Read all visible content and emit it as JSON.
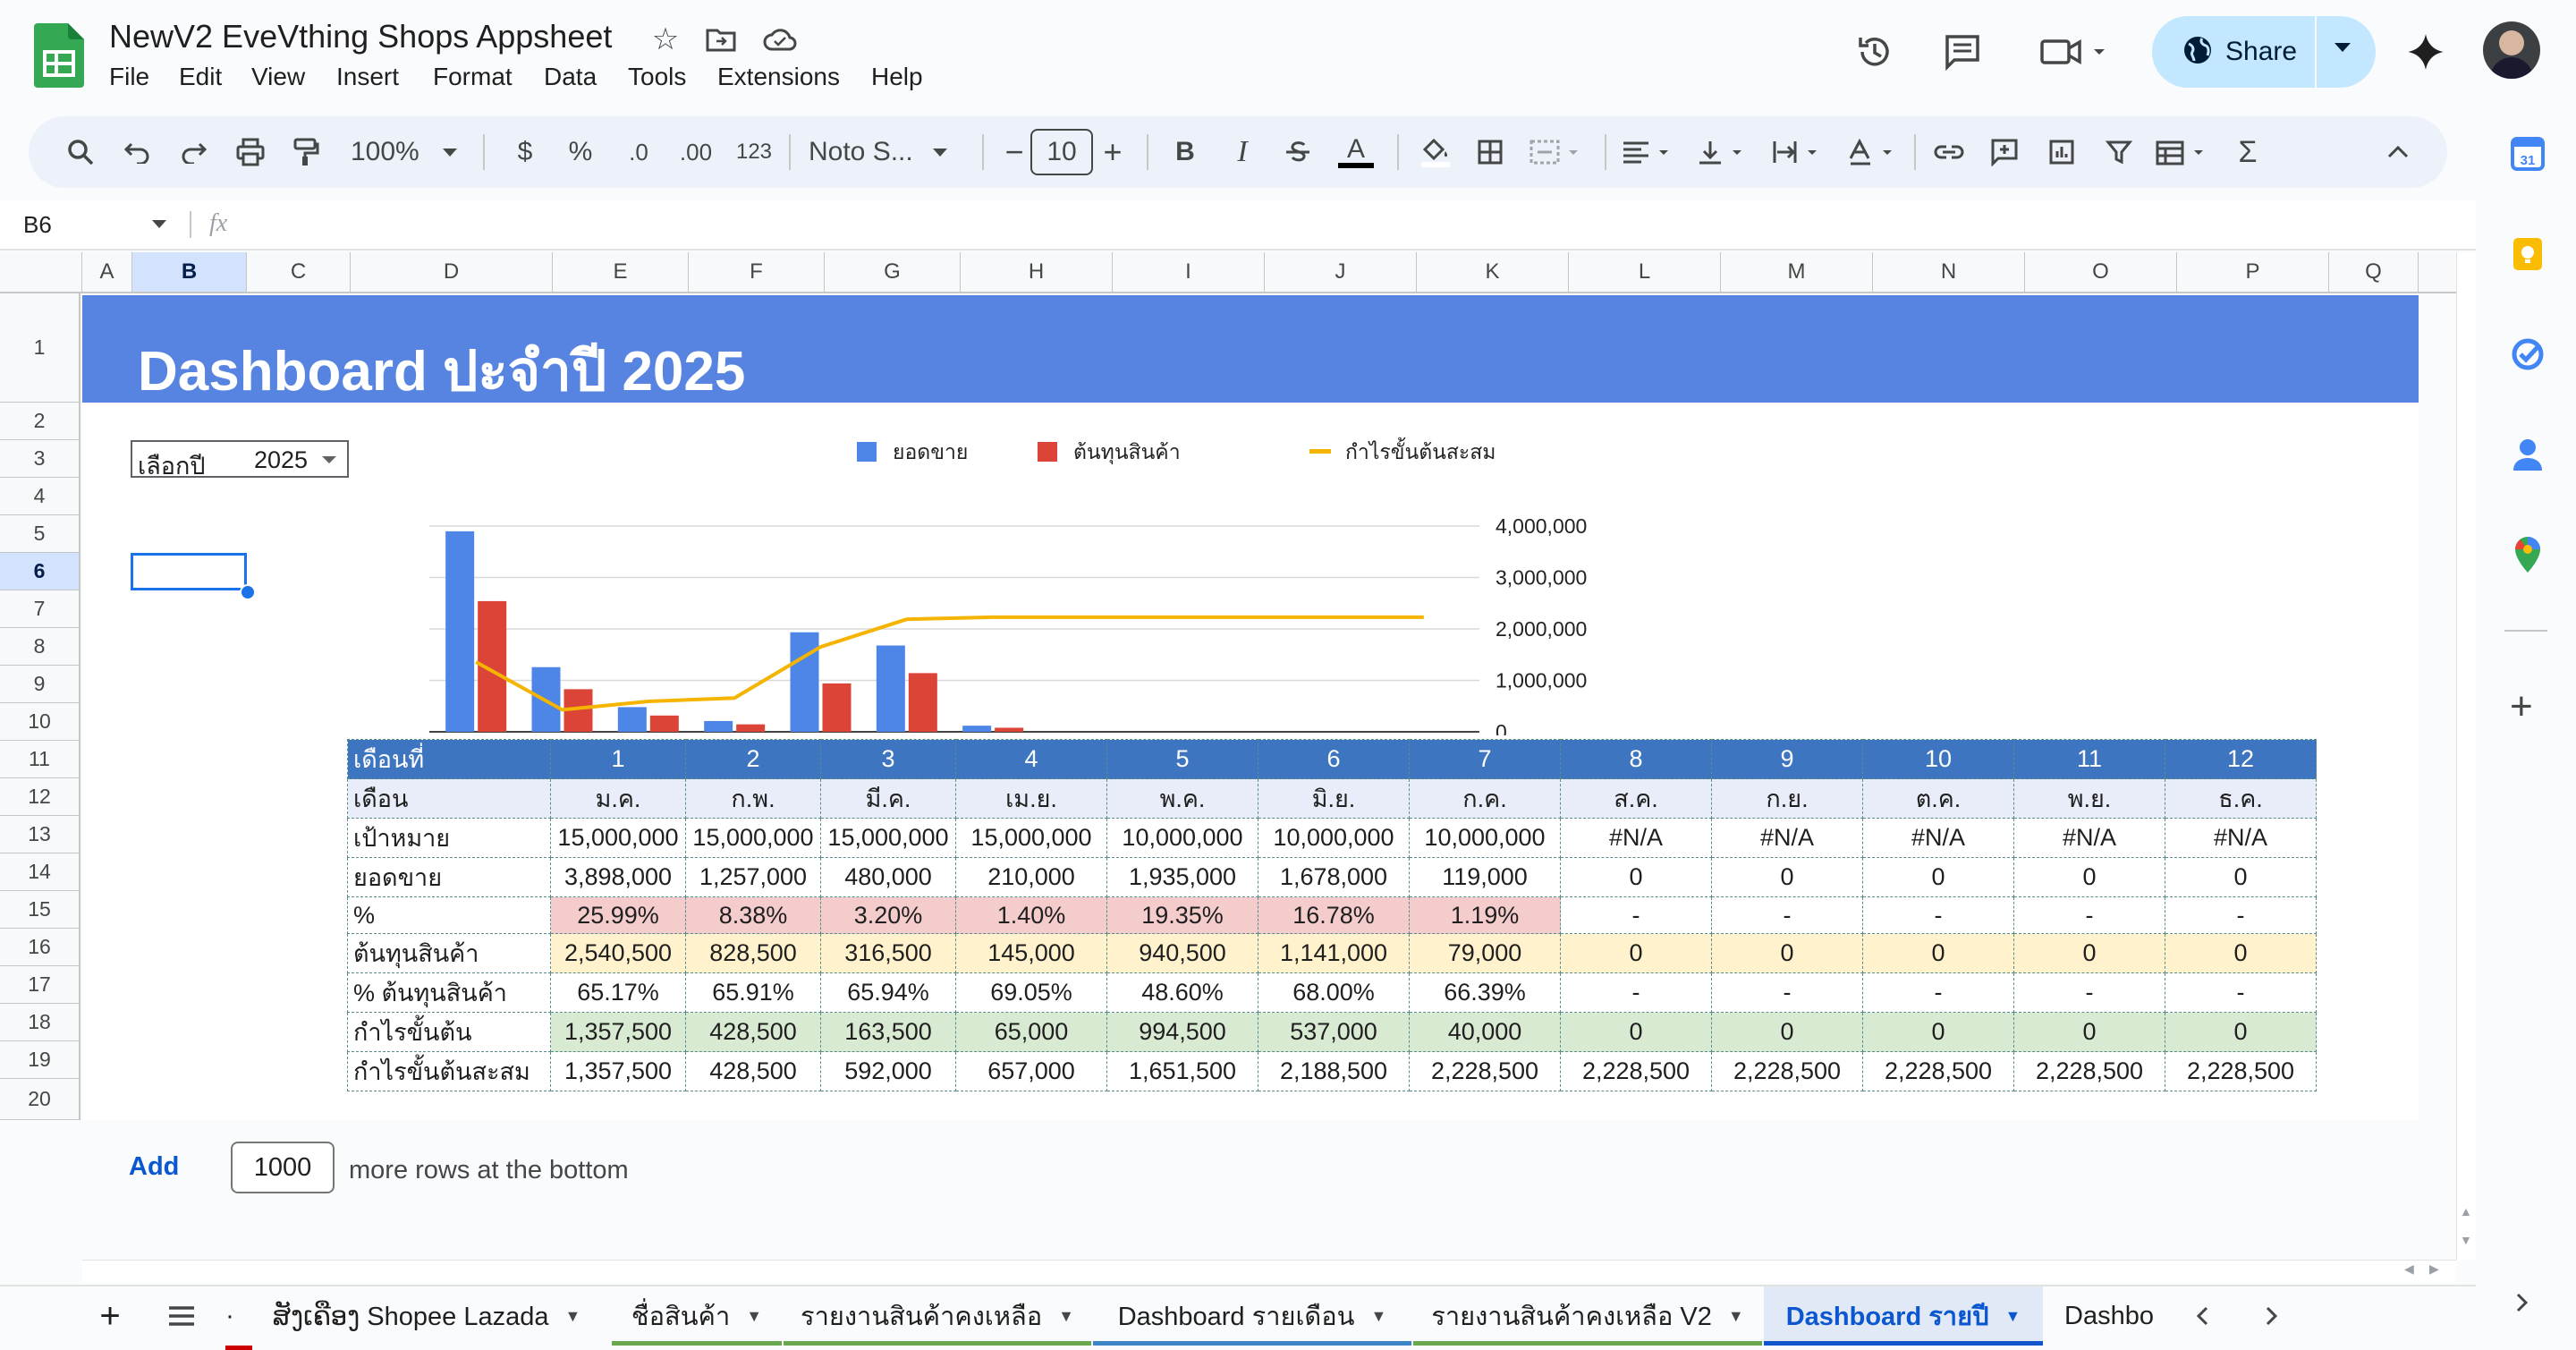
{
  "app": {
    "title": "NewV2 EveVthing Shops Appsheet",
    "menu": [
      "File",
      "Edit",
      "View",
      "Insert",
      "Format",
      "Data",
      "Tools",
      "Extensions",
      "Help"
    ],
    "share_label": "Share"
  },
  "toolbar": {
    "zoom": "100%",
    "currency": "$",
    "percent": "%",
    "dec_decrease": ".0",
    "dec_increase": ".00",
    "number_format": "123",
    "font": "Noto S...",
    "font_size": "10",
    "bold": "B",
    "italic": "I",
    "text_color_glyph": "A"
  },
  "formula_bar": {
    "name_box": "B6",
    "fx": "fx",
    "content": ""
  },
  "columns": [
    "A",
    "B",
    "C",
    "D",
    "E",
    "F",
    "G",
    "H",
    "I",
    "J",
    "K",
    "L",
    "M",
    "N",
    "O",
    "P",
    "Q"
  ],
  "rows": [
    "1",
    "2",
    "3",
    "4",
    "5",
    "6",
    "7",
    "8",
    "9",
    "10",
    "11",
    "12",
    "13",
    "14",
    "15",
    "16",
    "17",
    "18",
    "19",
    "20"
  ],
  "dashboard": {
    "title": "Dashboard ปะจำปี 2025",
    "year_label": "เลือกปี",
    "year_value": "2025"
  },
  "chart_data": {
    "type": "bar",
    "categories": [
      "ม.ค.",
      "ก.พ.",
      "มี.ค.",
      "เม.ย.",
      "พ.ค.",
      "มิ.ย.",
      "ก.ค.",
      "ส.ค.",
      "ก.ย.",
      "ต.ค.",
      "พ.ย.",
      "ธ.ค."
    ],
    "series": [
      {
        "name": "ยอดขาย",
        "type": "bar",
        "color": "#4e86e8",
        "values": [
          3898000,
          1257000,
          480000,
          210000,
          1935000,
          1678000,
          119000,
          0,
          0,
          0,
          0,
          0
        ]
      },
      {
        "name": "ต้นทุนสินค้า",
        "type": "bar",
        "color": "#db4437",
        "values": [
          2540500,
          828500,
          316500,
          145000,
          940500,
          1141000,
          79000,
          0,
          0,
          0,
          0,
          0
        ]
      },
      {
        "name": "กำไรขั้นต้นสะสม",
        "type": "line",
        "color": "#f4b400",
        "values": [
          1357500,
          428500,
          592000,
          657000,
          1651500,
          2188500,
          2228500,
          2228500,
          2228500,
          2228500,
          2228500,
          2228500
        ]
      }
    ],
    "ylim": [
      0,
      4000000
    ],
    "yticks": [
      "4,000,000",
      "3,000,000",
      "2,000,000",
      "1,000,000",
      "0"
    ],
    "legend_position": "top",
    "grid": true
  },
  "table": {
    "month_no_label": "เดือนที่",
    "month_nos": [
      "1",
      "2",
      "3",
      "4",
      "5",
      "6",
      "7",
      "8",
      "9",
      "10",
      "11",
      "12"
    ],
    "month_label": "เดือน",
    "months": [
      "ม.ค.",
      "ก.พ.",
      "มี.ค.",
      "เม.ย.",
      "พ.ค.",
      "มิ.ย.",
      "ก.ค.",
      "ส.ค.",
      "ก.ย.",
      "ต.ค.",
      "พ.ย.",
      "ธ.ค."
    ],
    "rows": [
      {
        "label": "เป้าหมาย",
        "cls": "target",
        "values": [
          "15,000,000",
          "15,000,000",
          "15,000,000",
          "15,000,000",
          "10,000,000",
          "10,000,000",
          "10,000,000",
          "#N/A",
          "#N/A",
          "#N/A",
          "#N/A",
          "#N/A"
        ]
      },
      {
        "label": "ยอดขาย",
        "cls": "sales",
        "values": [
          "3,898,000",
          "1,257,000",
          "480,000",
          "210,000",
          "1,935,000",
          "1,678,000",
          "119,000",
          "0",
          "0",
          "0",
          "0",
          "0"
        ]
      },
      {
        "label": "%",
        "cls": "pct",
        "values": [
          "25.99%",
          "8.38%",
          "3.20%",
          "1.40%",
          "19.35%",
          "16.78%",
          "1.19%",
          "-",
          "-",
          "-",
          "-",
          "-"
        ]
      },
      {
        "label": "ต้นทุนสินค้า",
        "cls": "cost",
        "values": [
          "2,540,500",
          "828,500",
          "316,500",
          "145,000",
          "940,500",
          "1,141,000",
          "79,000",
          "0",
          "0",
          "0",
          "0",
          "0"
        ]
      },
      {
        "label": "% ต้นทุนสินค้า",
        "cls": "costpct",
        "values": [
          "65.17%",
          "65.91%",
          "65.94%",
          "69.05%",
          "48.60%",
          "68.00%",
          "66.39%",
          "-",
          "-",
          "-",
          "-",
          "-"
        ]
      },
      {
        "label": "กำไรขั้นต้น",
        "cls": "profit",
        "values": [
          "1,357,500",
          "428,500",
          "163,500",
          "65,000",
          "994,500",
          "537,000",
          "40,000",
          "0",
          "0",
          "0",
          "0",
          "0"
        ]
      },
      {
        "label": "กำไรขั้นต้นสะสม",
        "cls": "cum",
        "values": [
          "1,357,500",
          "428,500",
          "592,000",
          "657,000",
          "1,651,500",
          "2,188,500",
          "2,228,500",
          "2,228,500",
          "2,228,500",
          "2,228,500",
          "2,228,500",
          "2,228,500"
        ]
      }
    ]
  },
  "add_rows": {
    "add_label": "Add",
    "count": "1000",
    "suffix": "more rows at the bottom"
  },
  "tabs": [
    {
      "label": "ສັງເຄືອງ Shopee Lazada",
      "color": ""
    },
    {
      "label": "ชื่อสินค้า",
      "color": "#6aa84f"
    },
    {
      "label": "รายงานสินค้าคงเหลือ",
      "color": "#6aa84f"
    },
    {
      "label": "Dashboard รายเดือน",
      "color": "#3d85c6"
    },
    {
      "label": "รายงานสินค้าคงเหลือ V2",
      "color": "#6aa84f"
    },
    {
      "label": "Dashboard รายปี",
      "color": "#1155cc",
      "active": true
    },
    {
      "label": "Dashbo",
      "color": ""
    }
  ],
  "colors": {
    "accent": "#0b57d0",
    "banner": "#5784e0",
    "header_row": "#3d75c0"
  }
}
